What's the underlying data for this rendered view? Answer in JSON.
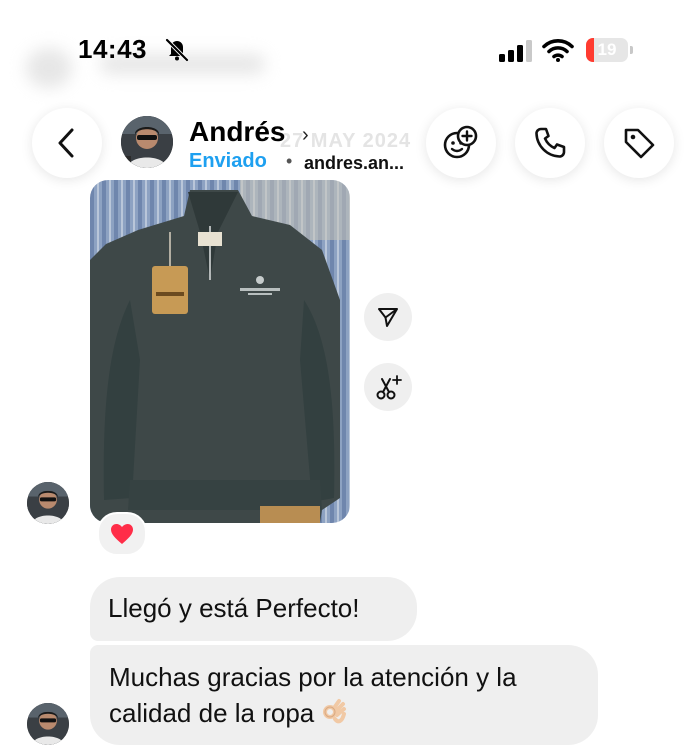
{
  "status_bar": {
    "time": "14:43",
    "battery_level": "19",
    "battery_fraction": 0.19,
    "icons": [
      "bell-slash-icon",
      "cellular-signal-icon",
      "wifi-icon",
      "battery-icon"
    ]
  },
  "header": {
    "contact_name": "Andrés",
    "name_chevron": "›",
    "ghost_date": "27 MAY 2024",
    "sent_status": "Enviado",
    "separator": "•",
    "username": "andres.an...",
    "icons": [
      "back-chevron-icon",
      "effects-icon",
      "phone-icon",
      "tag-icon"
    ]
  },
  "conversation": {
    "photo_icon_actions": [
      "share-icon",
      "remix-icon"
    ],
    "reaction": "❤️",
    "messages": [
      {
        "text": "Llegó y está Perfecto!"
      },
      {
        "text": "Muchas gracias por la atención y la calidad de la ropa",
        "emoji": "👌🏻"
      }
    ]
  },
  "colors": {
    "accent_blue": "#1ea0f0",
    "bubble_gray": "#efefef",
    "battery_red": "#ff3b30",
    "heart_red": "#ff2d48"
  }
}
